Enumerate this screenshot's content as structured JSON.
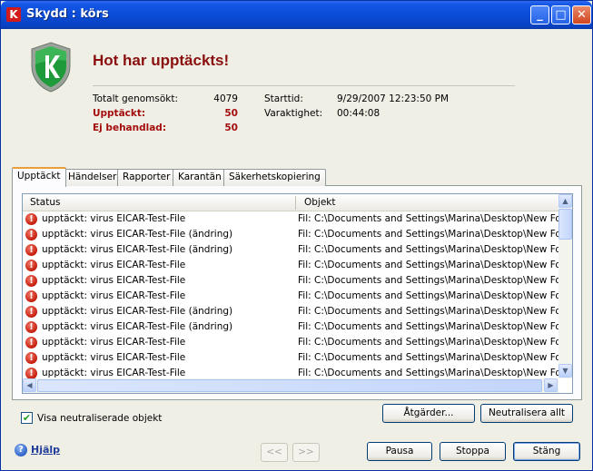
{
  "window": {
    "title": "Skydd : körs",
    "app_icon_letter": "K"
  },
  "header": {
    "headline": "Hot har upptäckts!",
    "stats": {
      "scanned_label": "Totalt genomsökt:",
      "scanned_value": "4079",
      "detected_label": "Upptäckt:",
      "detected_value": "50",
      "untreated_label": "Ej behandlad:",
      "untreated_value": "50",
      "start_label": "Starttid:",
      "start_value": "9/29/2007 12:23:50 PM",
      "duration_label": "Varaktighet:",
      "duration_value": "00:44:08"
    }
  },
  "tabs": [
    "Upptäckt",
    "Händelser",
    "Rapporter",
    "Karantän",
    "Säkerhetskopiering"
  ],
  "list": {
    "columns": [
      "Status",
      "Objekt"
    ],
    "rows": [
      {
        "status": "upptäckt: virus EICAR-Test-File",
        "object": "Fil: C:\\Documents and Settings\\Marina\\Desktop\\New Folder"
      },
      {
        "status": "upptäckt: virus EICAR-Test-File (ändring)",
        "object": "Fil: C:\\Documents and Settings\\Marina\\Desktop\\New Folder"
      },
      {
        "status": "upptäckt: virus EICAR-Test-File (ändring)",
        "object": "Fil: C:\\Documents and Settings\\Marina\\Desktop\\New Folder"
      },
      {
        "status": "upptäckt: virus EICAR-Test-File",
        "object": "Fil: C:\\Documents and Settings\\Marina\\Desktop\\New Folder"
      },
      {
        "status": "upptäckt: virus EICAR-Test-File",
        "object": "Fil: C:\\Documents and Settings\\Marina\\Desktop\\New Folder"
      },
      {
        "status": "upptäckt: virus EICAR-Test-File",
        "object": "Fil: C:\\Documents and Settings\\Marina\\Desktop\\New Folder"
      },
      {
        "status": "upptäckt: virus EICAR-Test-File (ändring)",
        "object": "Fil: C:\\Documents and Settings\\Marina\\Desktop\\New Folder"
      },
      {
        "status": "upptäckt: virus EICAR-Test-File (ändring)",
        "object": "Fil: C:\\Documents and Settings\\Marina\\Desktop\\New Folder"
      },
      {
        "status": "upptäckt: virus EICAR-Test-File",
        "object": "Fil: C:\\Documents and Settings\\Marina\\Desktop\\New Folder"
      },
      {
        "status": "upptäckt: virus EICAR-Test-File",
        "object": "Fil: C:\\Documents and Settings\\Marina\\Desktop\\New Folder"
      },
      {
        "status": "upptäckt: virus EICAR-Test-File",
        "object": "Fil: C:\\Documents and Settings\\Marina\\Desktop\\New Folder"
      }
    ],
    "row_icon": "warning-icon"
  },
  "checkbox": {
    "label": "Visa neutraliserade objekt",
    "checked": true
  },
  "buttons": {
    "actions": "Åtgärder...",
    "neutralize_all": "Neutralisera allt",
    "prev": "<<",
    "next": ">>",
    "pause": "Pausa",
    "stop": "Stoppa",
    "close": "Stäng"
  },
  "help": {
    "label": "Hjälp"
  },
  "colors": {
    "headline": "#8a0f0f",
    "title_bar": "#0a4cd7",
    "warning": "#c51c0c"
  }
}
